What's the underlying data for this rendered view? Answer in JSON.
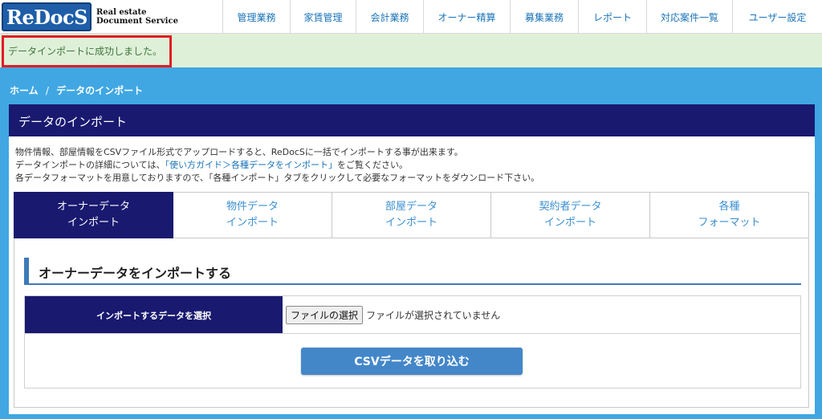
{
  "header": {
    "logo_text": "ReDocS",
    "logo_sub_line1": "Real estate",
    "logo_sub_line2": "Document Service",
    "nav": [
      {
        "label": "管理業務"
      },
      {
        "label": "家賃管理"
      },
      {
        "label": "会計業務"
      },
      {
        "label": "オーナー精算"
      },
      {
        "label": "募集業務"
      },
      {
        "label": "レポート"
      },
      {
        "label": "対応案件一覧"
      },
      {
        "label": "ユーザー設定"
      }
    ]
  },
  "alert": {
    "message": "データインポートに成功しました。",
    "color": "#dff0d8",
    "highlight_color": "#e31b23"
  },
  "breadcrumb": {
    "home": "ホーム",
    "separator": "/",
    "current": "データのインポート"
  },
  "panel": {
    "title": "データのインポート",
    "desc_line1": "物件情報、部屋情報をCSVファイル形式でアップロードすると、ReDocSに一括でインポートする事が出来ます。",
    "desc_line2_prefix": "データインポートの詳細については、",
    "desc_line2_link": "「使い方ガイド＞各種データをインポート」",
    "desc_line2_suffix": "をご覧ください。",
    "desc_line3": "各データフォーマットを用意しておりますので、「各種インポート」タブをクリックして必要なフォーマットをダウンロード下さい。"
  },
  "tabs": [
    {
      "line1": "オーナーデータ",
      "line2": "インポート",
      "active": true
    },
    {
      "line1": "物件データ",
      "line2": "インポート",
      "active": false
    },
    {
      "line1": "部屋データ",
      "line2": "インポート",
      "active": false
    },
    {
      "line1": "契約者データ",
      "line2": "インポート",
      "active": false
    },
    {
      "line1": "各種",
      "line2": "フォーマット",
      "active": false
    }
  ],
  "form": {
    "section_title": "オーナーデータをインポートする",
    "label": "インポートするデータを選択",
    "file_button": "ファイルの選択",
    "file_status": "ファイルが選択されていません",
    "submit": "CSVデータを取り込む"
  },
  "colors": {
    "navy": "#191970",
    "main_bg": "#40a7e3",
    "accent": "#4387c9"
  }
}
